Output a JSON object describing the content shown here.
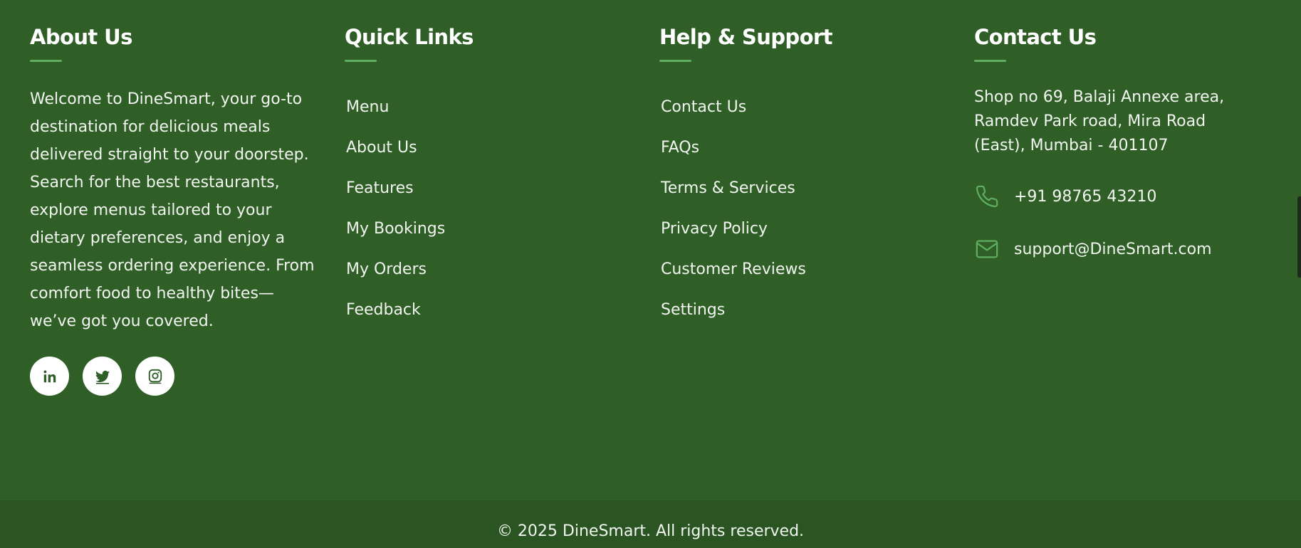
{
  "about": {
    "title": "About Us",
    "text": "Welcome to DineSmart, your go-to destination for delicious meals delivered straight to your doorstep. Search for the best restaurants, explore menus tailored to your dietary preferences, and enjoy a seamless ordering experience. From comfort food to healthy bites—we’ve got you covered.",
    "social": [
      {
        "name": "linkedin",
        "icon": "linkedin-icon"
      },
      {
        "name": "twitter",
        "icon": "twitter-icon"
      },
      {
        "name": "instagram",
        "icon": "instagram-icon"
      }
    ]
  },
  "quick_links": {
    "title": "Quick Links",
    "items": [
      "Menu",
      "About Us",
      "Features",
      "My Bookings",
      "My Orders",
      "Feedback"
    ]
  },
  "help": {
    "title": "Help & Support",
    "items": [
      "Contact Us",
      "FAQs",
      "Terms & Services",
      "Privacy Policy",
      "Customer Reviews",
      "Settings"
    ]
  },
  "contact": {
    "title": "Contact Us",
    "address": "Shop no 69, Balaji Annexe area, Ramdev Park road, Mira Road (East), Mumbai - 401107",
    "phone": "+91 98765 43210",
    "email": "support@DineSmart.com",
    "phone_icon": "phone-icon",
    "email_icon": "mail-icon"
  },
  "footer": {
    "copyright": "© 2025 DineSmart. All rights reserved."
  },
  "colors": {
    "background": "#2f5e27",
    "bottom_bar": "#2a5522",
    "accent": "#5fae5f",
    "text": "#ffffff"
  }
}
